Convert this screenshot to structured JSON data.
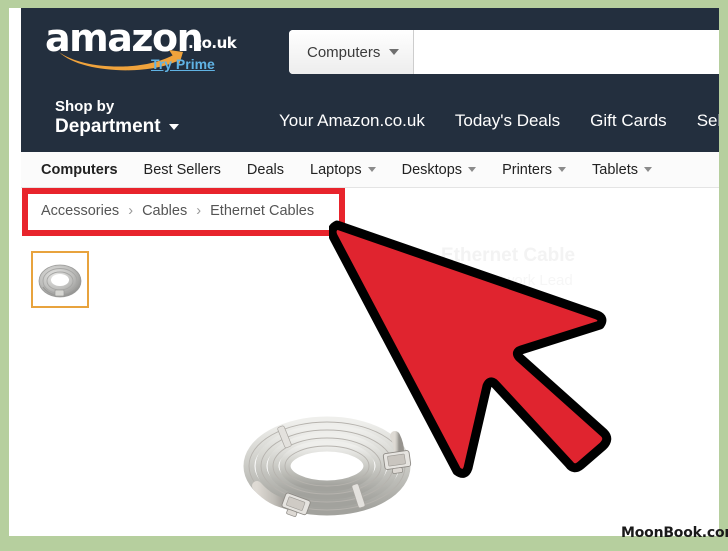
{
  "site": {
    "logo_text": "amazon",
    "logo_tld": ".co.uk",
    "prime_link": "Try Prime"
  },
  "search": {
    "category": "Computers",
    "value": "",
    "placeholder": ""
  },
  "header": {
    "shop_by_line1": "Shop by",
    "shop_by_line2": "Department",
    "nav_links": [
      "Your Amazon.co.uk",
      "Today's Deals",
      "Gift Cards",
      "Sell"
    ]
  },
  "subnav": {
    "items": [
      {
        "label": "Computers",
        "active": true,
        "caret": false
      },
      {
        "label": "Best Sellers",
        "active": false,
        "caret": false
      },
      {
        "label": "Deals",
        "active": false,
        "caret": false
      },
      {
        "label": "Laptops",
        "active": false,
        "caret": true
      },
      {
        "label": "Desktops",
        "active": false,
        "caret": true
      },
      {
        "label": "Printers",
        "active": false,
        "caret": true
      },
      {
        "label": "Tablets",
        "active": false,
        "caret": true
      }
    ]
  },
  "breadcrumb": {
    "crumb1": "Accessories",
    "sep1": "›",
    "crumb2": "Cables",
    "sep2": "›",
    "crumb3": "Ethernet Cables"
  },
  "product": {
    "thumbnail_alt": "ethernet-cable-thumbnail",
    "main_image_alt": "coiled-grey-ethernet-cable",
    "ghost_title": "Ethernet Cable",
    "ghost_subtitle": "RJ45 Network Lead"
  },
  "annotation": {
    "highlight_target": "breadcrumb",
    "cursor_type": "arrow-pointer"
  },
  "watermark": {
    "text": "MoonBook.com"
  },
  "colors": {
    "header_navy": "#232f3e",
    "amazon_orange": "#f0a33c",
    "prime_blue": "#60b3e4",
    "highlight_red": "#e8242c",
    "cursor_red": "#e0242f",
    "frame_green": "#b6cf9e",
    "thumb_border_orange": "#e8a33d"
  }
}
